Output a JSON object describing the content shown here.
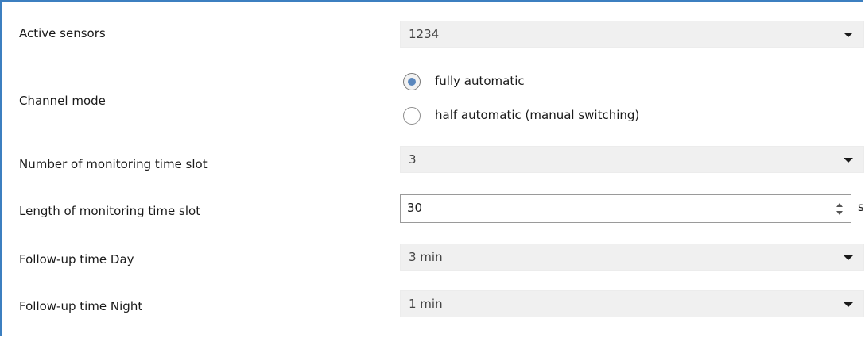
{
  "rows": {
    "active_sensors": {
      "label": "Active sensors",
      "value": "1234"
    },
    "channel_mode": {
      "label": "Channel mode",
      "options": [
        "fully automatic",
        "half automatic (manual switching)"
      ],
      "selected": 0
    },
    "monitoring_slot_count": {
      "label": "Number of monitoring time slot",
      "value": "3"
    },
    "monitoring_slot_length": {
      "label": "Length of monitoring time slot",
      "value": "30",
      "unit": "s"
    },
    "followup_day": {
      "label": "Follow-up time Day",
      "value": "3 min"
    },
    "followup_night": {
      "label": "Follow-up time Night",
      "value": "1 min"
    }
  },
  "colors": {
    "frame_accent": "#3c7fc0",
    "radio_selected": "#5a87bd",
    "select_bg": "#f0f0f0"
  },
  "icons": {
    "dropdown": "chevron-down-icon",
    "spinner": "spinner-arrows-icon"
  }
}
